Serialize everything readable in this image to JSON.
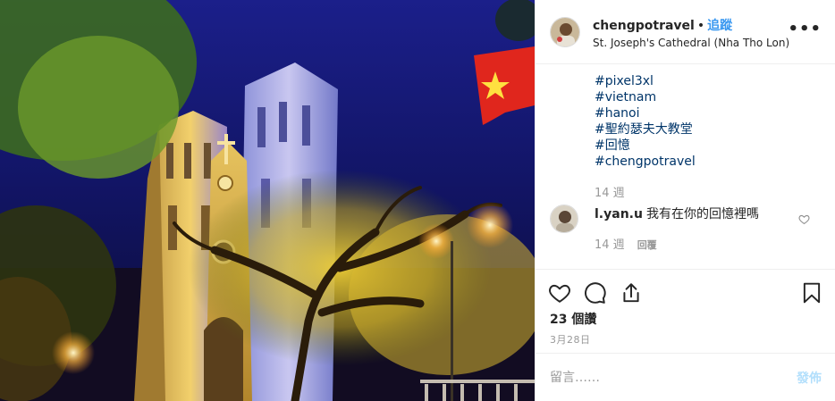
{
  "post": {
    "photo_icon": "cathedral-night-photo",
    "header": {
      "username": "chengpotravel",
      "separator": "•",
      "follow_label": "追蹤",
      "location": "St. Joseph's Cathedral (Nha Tho Lon)",
      "more_icon": "more-options-icon",
      "more_label": "•••"
    },
    "caption": {
      "hashtags": [
        "#pixel3xl",
        "#vietnam",
        "#hanoi",
        "#聖約瑟夫大教堂",
        "#回憶",
        "#chengpotravel"
      ],
      "time": "14 週"
    },
    "comments": [
      {
        "username": "l.yan.u",
        "text": "我有在你的回憶裡嗎",
        "time": "14 週",
        "reply_label": "回覆"
      }
    ],
    "actions": {
      "like_icon": "heart-icon",
      "comment_icon": "comment-icon",
      "share_icon": "share-icon",
      "save_icon": "bookmark-icon"
    },
    "likes": "23 個讚",
    "date": "3月28日",
    "comment_input": {
      "placeholder": "留言……",
      "value": ""
    },
    "post_label": "發佈",
    "colors": {
      "link_blue": "#003569",
      "follow_blue": "#3897f0",
      "post_disabled": "#b2dffc",
      "muted_gray": "#999999"
    }
  }
}
